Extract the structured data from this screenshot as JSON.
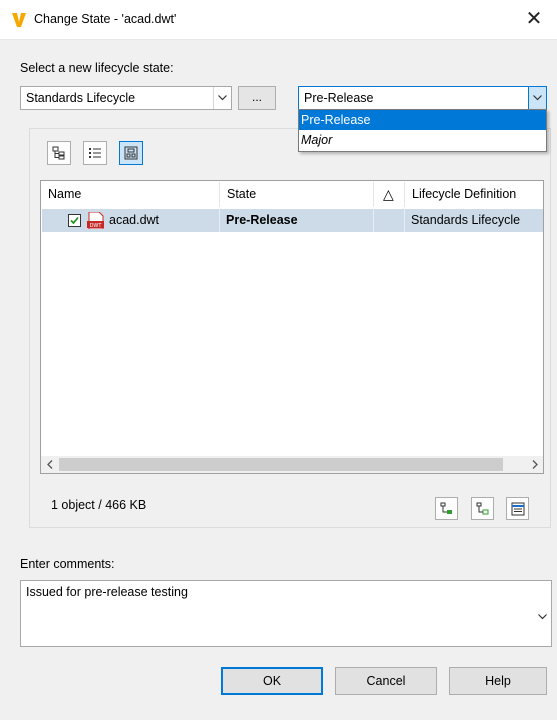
{
  "window": {
    "title": "Change State - 'acad.dwt'",
    "app_icon": "vault-v-icon",
    "close_glyph": "✕"
  },
  "select_label": "Select a new lifecycle state:",
  "lifecycle_combo": {
    "value": "Standards Lifecycle",
    "browse_label": "..."
  },
  "state_combo": {
    "value": "Pre-Release"
  },
  "state_dropdown": {
    "options": [
      "Pre-Release",
      "Major"
    ],
    "selected": "Pre-Release"
  },
  "grid": {
    "columns": [
      "Name",
      "State",
      "△",
      "Lifecycle Definition"
    ],
    "rows": [
      {
        "checked": true,
        "icon": "dwt-file-icon",
        "icon_text": "DWT",
        "name": "acad.dwt",
        "state": "Pre-Release",
        "flag": "",
        "lifecycle": "Standards Lifecycle"
      }
    ]
  },
  "status": {
    "text": "1 object / 466 KB"
  },
  "comments": {
    "label": "Enter comments:",
    "value": "Issued for pre-release testing"
  },
  "buttons": {
    "ok": "OK",
    "cancel": "Cancel",
    "help": "Help"
  },
  "colors": {
    "accent": "#0078d7",
    "row_selected": "#cddbe8",
    "app_icon": "#f5a800",
    "file_icon": "#d32f2f"
  }
}
